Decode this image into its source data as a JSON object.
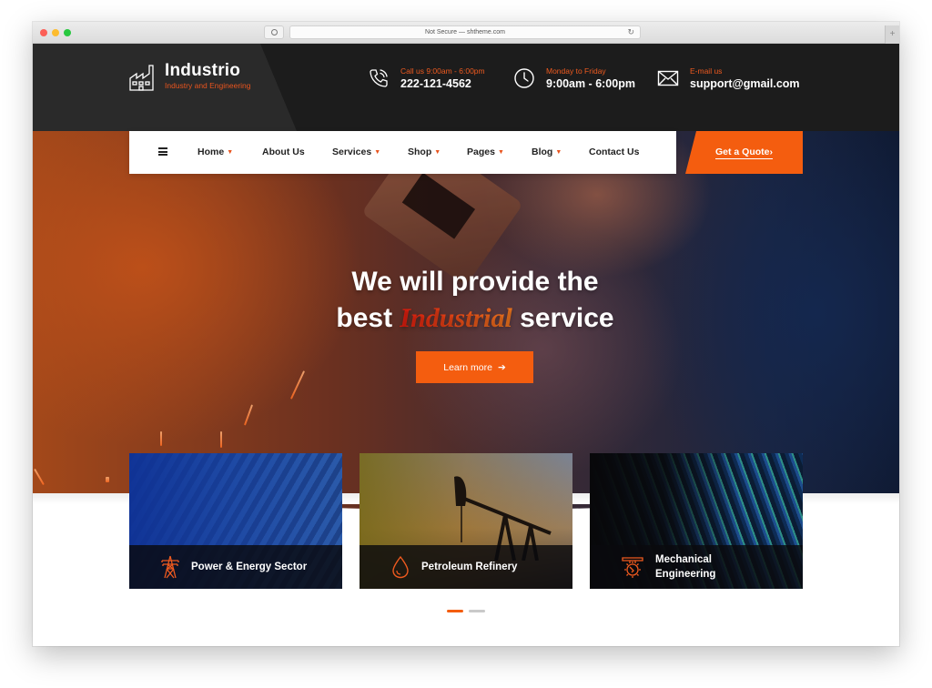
{
  "browser": {
    "url_text": "Not Secure — shtheme.com",
    "new_tab_symbol": "+"
  },
  "brand": {
    "name": "Industrio",
    "tagline": "Industry and Engineering",
    "accent_color": "#f45d0f"
  },
  "contacts": [
    {
      "icon": "phone-icon",
      "label": "Call us 9:00am - 6:00pm",
      "value": "222-121-4562"
    },
    {
      "icon": "clock-icon",
      "label": "Monday to Friday",
      "value": "9:00am - 6:00pm"
    },
    {
      "icon": "envelope-icon",
      "label": "E-mail us",
      "value": "support@gmail.com"
    }
  ],
  "nav": {
    "menu_icon": "hamburger-icon",
    "items": [
      {
        "label": "Home",
        "dropdown": true
      },
      {
        "label": "About Us",
        "dropdown": false
      },
      {
        "label": "Services",
        "dropdown": true
      },
      {
        "label": "Shop",
        "dropdown": true
      },
      {
        "label": "Pages",
        "dropdown": true
      },
      {
        "label": "Blog",
        "dropdown": true
      },
      {
        "label": "Contact Us",
        "dropdown": false
      }
    ],
    "caret": "▼",
    "quote_button": "Get a Quote",
    "quote_arrow": "›"
  },
  "hero": {
    "title_line1": "We will provide the",
    "title_line2_before": "best ",
    "title_line2_accent": "Industrial",
    "title_line2_after": " service",
    "cta_label": "Learn more",
    "cta_arrow": "➔"
  },
  "cards": [
    {
      "label_line1": "Power & Energy Sector",
      "label_line2": "",
      "icon": "power-tower-icon"
    },
    {
      "label_line1": "Petroleum Refinery",
      "label_line2": "",
      "icon": "oil-drop-icon"
    },
    {
      "label_line1": "Mechanical",
      "label_line2": "Engineering",
      "icon": "gear-icon"
    }
  ],
  "slider": {
    "total_slides": 2,
    "active_slide": 1
  }
}
